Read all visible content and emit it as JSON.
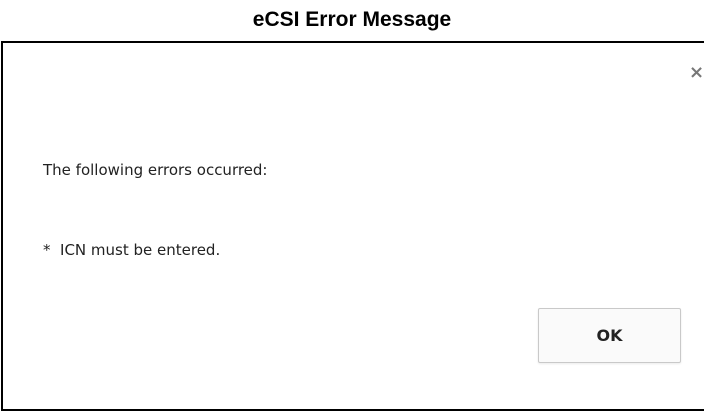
{
  "caption": "eCSI Error Message",
  "dialog": {
    "close_glyph": "×",
    "heading": "The following errors occurred:",
    "errors": [
      "*  ICN must be entered."
    ],
    "ok_label": "OK"
  }
}
